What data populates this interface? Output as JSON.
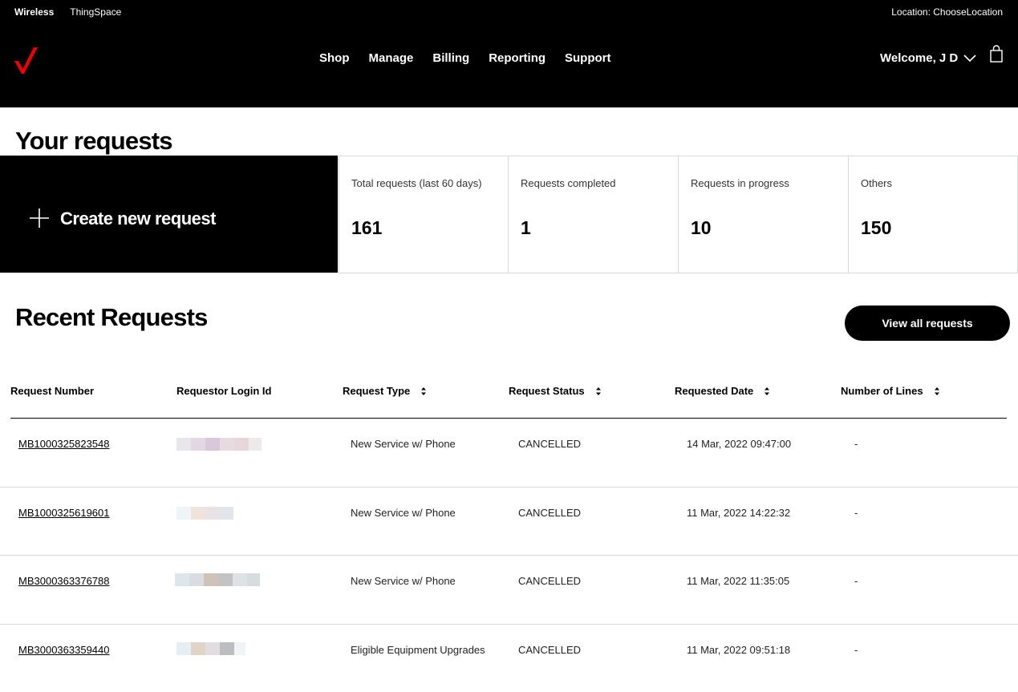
{
  "header": {
    "top_links": [
      "Wireless",
      "ThingSpace"
    ],
    "location": "Location: ChooseLocation",
    "nav": [
      "Shop",
      "Manage",
      "Billing",
      "Reporting",
      "Support"
    ],
    "welcome": "Welcome, J D",
    "brand_color": "#ee0000"
  },
  "summary": {
    "title": "Your requests",
    "create_label": "Create new request",
    "stats": [
      {
        "label": "Total requests (last 60 days)",
        "value": "161"
      },
      {
        "label": "Requests completed",
        "value": "1"
      },
      {
        "label": "Requests in progress",
        "value": "10"
      },
      {
        "label": "Others",
        "value": "150"
      }
    ]
  },
  "recent": {
    "title": "Recent Requests",
    "view_all_label": "View all requests",
    "columns": [
      "Request Number",
      "Requestor Login Id",
      "Request Type",
      "Request Status",
      "Requested Date",
      "Number of Lines"
    ],
    "rows": [
      {
        "number": "MB1000325823548",
        "type": "New Service w/ Phone",
        "status": "CANCELLED",
        "date": "14 Mar, 2022 09:47:00",
        "lines": "-"
      },
      {
        "number": "MB1000325619601",
        "type": "New Service w/ Phone",
        "status": "CANCELLED",
        "date": "11 Mar, 2022 14:22:32",
        "lines": "-"
      },
      {
        "number": "MB3000363376788",
        "type": "New Service w/ Phone",
        "status": "CANCELLED",
        "date": "11 Mar, 2022 11:35:05",
        "lines": "-"
      },
      {
        "number": "MB3000363359440",
        "type": "Eligible Equipment Upgrades",
        "status": "CANCELLED",
        "date": "11 Mar, 2022 09:51:18",
        "lines": "-"
      }
    ]
  }
}
